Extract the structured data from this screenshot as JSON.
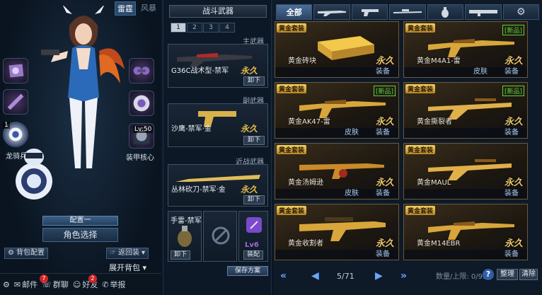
{
  "char_panel": {
    "mode_tabs": [
      "雷霆",
      "风暴"
    ],
    "slots": {
      "right_mid_label": "装甲核心",
      "right_mid_lv": "Lv:50",
      "left_bottom_label": "龙骑兵",
      "left_bottom_num": "1"
    },
    "preset": "配置一",
    "role_select": "角色选择",
    "backpack_config": "背包配置",
    "back_button": "返回装",
    "expand_backpack": "展开背包"
  },
  "bottom_bar": {
    "mail": "邮件",
    "mail_badge": "7",
    "group": "群聊",
    "friends": "好友",
    "friends_badge": "2",
    "report": "举报"
  },
  "loadout": {
    "title": "战斗武器",
    "set_tabs": [
      "1",
      "2",
      "3",
      "4"
    ],
    "active_set": "1",
    "primary_label": "主武器",
    "primary_name": "G36C战术型-禁军",
    "secondary_label": "副武器",
    "secondary_name": "沙鹰-禁军·金",
    "melee_label": "近战武器",
    "melee_name": "丛林砍刀-禁军·金",
    "permanent": "永久",
    "unequip": "卸下",
    "grenade_name": "手雷-禁军",
    "level_tag": "Lv6",
    "equip": "装配",
    "save_plan": "保存方案"
  },
  "inventory": {
    "tabs": [
      "全部",
      "rifle-icon",
      "pistol-icon",
      "sniper-icon",
      "grenade-icon",
      "launcher-icon",
      "gear-icon"
    ],
    "active_tab": "全部",
    "cards": [
      {
        "tag": "黄金套装",
        "name": "黄金砖块",
        "perm": "永久",
        "new": "",
        "foot": [
          "装备"
        ],
        "art": "gold-bar"
      },
      {
        "tag": "黄金套装",
        "name": "黄金M4A1-雷",
        "perm": "永久",
        "new": "[新品]",
        "foot": [
          "皮肤",
          "装备"
        ],
        "art": "rifle"
      },
      {
        "tag": "黄金套装",
        "name": "黄金AK47-雷",
        "perm": "永久",
        "new": "[新品]",
        "foot": [
          "皮肤",
          "装备"
        ],
        "art": "rifle"
      },
      {
        "tag": "黄金套装",
        "name": "黄金撕裂者",
        "perm": "永久",
        "new": "[新品]",
        "foot": [
          "装备"
        ],
        "art": "shotgun"
      },
      {
        "tag": "黄金套装",
        "name": "黄金汤姆逊",
        "perm": "永久",
        "new": "",
        "foot": [
          "皮肤",
          "装备"
        ],
        "art": "smg"
      },
      {
        "tag": "黄金套装",
        "name": "黄金MAUL",
        "perm": "永久",
        "new": "",
        "foot": [
          "装备"
        ],
        "art": "shotgun"
      },
      {
        "tag": "黄金套装",
        "name": "黄金收割者",
        "perm": "永久",
        "new": "",
        "foot": [
          "装备"
        ],
        "art": "mg"
      },
      {
        "tag": "黄金套装",
        "name": "黄金M14EBR",
        "perm": "永久",
        "new": "",
        "foot": [
          "装备"
        ],
        "art": "rifle"
      }
    ],
    "pager": {
      "page": "5/71"
    },
    "capacity": "数量/上限: 0/99",
    "sort": "整理",
    "clear": "清除"
  },
  "colors": {
    "gold": "#e7c56a",
    "new_green": "#5ad63c",
    "accent_blue": "#6aa6ff",
    "badge_red": "#d12424"
  }
}
